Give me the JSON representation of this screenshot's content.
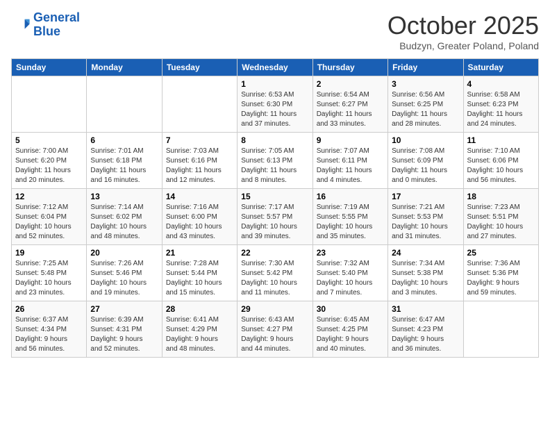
{
  "logo": {
    "line1": "General",
    "line2": "Blue"
  },
  "title": "October 2025",
  "subtitle": "Budzyn, Greater Poland, Poland",
  "days_header": [
    "Sunday",
    "Monday",
    "Tuesday",
    "Wednesday",
    "Thursday",
    "Friday",
    "Saturday"
  ],
  "weeks": [
    [
      {
        "num": "",
        "info": ""
      },
      {
        "num": "",
        "info": ""
      },
      {
        "num": "",
        "info": ""
      },
      {
        "num": "1",
        "info": "Sunrise: 6:53 AM\nSunset: 6:30 PM\nDaylight: 11 hours\nand 37 minutes."
      },
      {
        "num": "2",
        "info": "Sunrise: 6:54 AM\nSunset: 6:27 PM\nDaylight: 11 hours\nand 33 minutes."
      },
      {
        "num": "3",
        "info": "Sunrise: 6:56 AM\nSunset: 6:25 PM\nDaylight: 11 hours\nand 28 minutes."
      },
      {
        "num": "4",
        "info": "Sunrise: 6:58 AM\nSunset: 6:23 PM\nDaylight: 11 hours\nand 24 minutes."
      }
    ],
    [
      {
        "num": "5",
        "info": "Sunrise: 7:00 AM\nSunset: 6:20 PM\nDaylight: 11 hours\nand 20 minutes."
      },
      {
        "num": "6",
        "info": "Sunrise: 7:01 AM\nSunset: 6:18 PM\nDaylight: 11 hours\nand 16 minutes."
      },
      {
        "num": "7",
        "info": "Sunrise: 7:03 AM\nSunset: 6:16 PM\nDaylight: 11 hours\nand 12 minutes."
      },
      {
        "num": "8",
        "info": "Sunrise: 7:05 AM\nSunset: 6:13 PM\nDaylight: 11 hours\nand 8 minutes."
      },
      {
        "num": "9",
        "info": "Sunrise: 7:07 AM\nSunset: 6:11 PM\nDaylight: 11 hours\nand 4 minutes."
      },
      {
        "num": "10",
        "info": "Sunrise: 7:08 AM\nSunset: 6:09 PM\nDaylight: 11 hours\nand 0 minutes."
      },
      {
        "num": "11",
        "info": "Sunrise: 7:10 AM\nSunset: 6:06 PM\nDaylight: 10 hours\nand 56 minutes."
      }
    ],
    [
      {
        "num": "12",
        "info": "Sunrise: 7:12 AM\nSunset: 6:04 PM\nDaylight: 10 hours\nand 52 minutes."
      },
      {
        "num": "13",
        "info": "Sunrise: 7:14 AM\nSunset: 6:02 PM\nDaylight: 10 hours\nand 48 minutes."
      },
      {
        "num": "14",
        "info": "Sunrise: 7:16 AM\nSunset: 6:00 PM\nDaylight: 10 hours\nand 43 minutes."
      },
      {
        "num": "15",
        "info": "Sunrise: 7:17 AM\nSunset: 5:57 PM\nDaylight: 10 hours\nand 39 minutes."
      },
      {
        "num": "16",
        "info": "Sunrise: 7:19 AM\nSunset: 5:55 PM\nDaylight: 10 hours\nand 35 minutes."
      },
      {
        "num": "17",
        "info": "Sunrise: 7:21 AM\nSunset: 5:53 PM\nDaylight: 10 hours\nand 31 minutes."
      },
      {
        "num": "18",
        "info": "Sunrise: 7:23 AM\nSunset: 5:51 PM\nDaylight: 10 hours\nand 27 minutes."
      }
    ],
    [
      {
        "num": "19",
        "info": "Sunrise: 7:25 AM\nSunset: 5:48 PM\nDaylight: 10 hours\nand 23 minutes."
      },
      {
        "num": "20",
        "info": "Sunrise: 7:26 AM\nSunset: 5:46 PM\nDaylight: 10 hours\nand 19 minutes."
      },
      {
        "num": "21",
        "info": "Sunrise: 7:28 AM\nSunset: 5:44 PM\nDaylight: 10 hours\nand 15 minutes."
      },
      {
        "num": "22",
        "info": "Sunrise: 7:30 AM\nSunset: 5:42 PM\nDaylight: 10 hours\nand 11 minutes."
      },
      {
        "num": "23",
        "info": "Sunrise: 7:32 AM\nSunset: 5:40 PM\nDaylight: 10 hours\nand 7 minutes."
      },
      {
        "num": "24",
        "info": "Sunrise: 7:34 AM\nSunset: 5:38 PM\nDaylight: 10 hours\nand 3 minutes."
      },
      {
        "num": "25",
        "info": "Sunrise: 7:36 AM\nSunset: 5:36 PM\nDaylight: 9 hours\nand 59 minutes."
      }
    ],
    [
      {
        "num": "26",
        "info": "Sunrise: 6:37 AM\nSunset: 4:34 PM\nDaylight: 9 hours\nand 56 minutes."
      },
      {
        "num": "27",
        "info": "Sunrise: 6:39 AM\nSunset: 4:31 PM\nDaylight: 9 hours\nand 52 minutes."
      },
      {
        "num": "28",
        "info": "Sunrise: 6:41 AM\nSunset: 4:29 PM\nDaylight: 9 hours\nand 48 minutes."
      },
      {
        "num": "29",
        "info": "Sunrise: 6:43 AM\nSunset: 4:27 PM\nDaylight: 9 hours\nand 44 minutes."
      },
      {
        "num": "30",
        "info": "Sunrise: 6:45 AM\nSunset: 4:25 PM\nDaylight: 9 hours\nand 40 minutes."
      },
      {
        "num": "31",
        "info": "Sunrise: 6:47 AM\nSunset: 4:23 PM\nDaylight: 9 hours\nand 36 minutes."
      },
      {
        "num": "",
        "info": ""
      }
    ]
  ]
}
